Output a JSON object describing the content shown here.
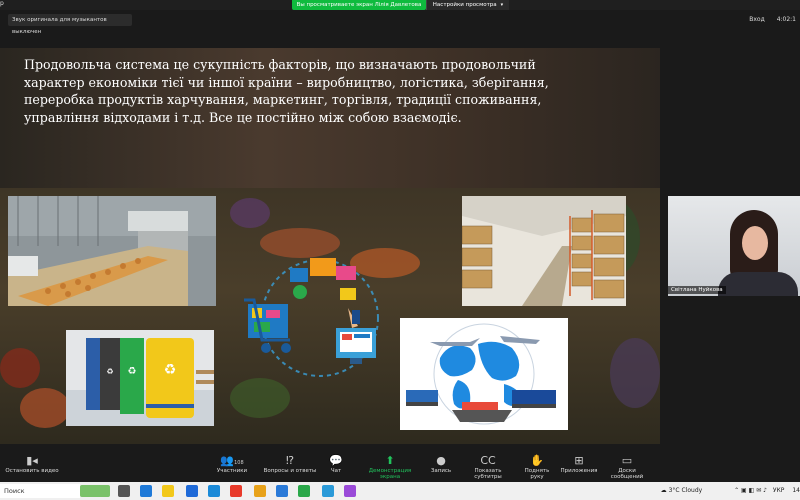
{
  "window": {
    "title_fragment": "р"
  },
  "banner": {
    "text": "Вы просматриваете экран Лілія Давлетова",
    "view_options": "Настройки просмотра"
  },
  "sound_notice": "Звук оригинала для музыкантов выключен",
  "top_right": {
    "enter_label": "Вход",
    "time": "4:02:1"
  },
  "slide": {
    "text": "Продовольча система це сукупність факторів, що визначають продовольчий характер економіки тієї чи іншої країни – виробництво, логістика, зберігання, переробка продуктів харчування, маркетинг, торгівля, традиції споживання, управління відходами і т.д. Все це постійно між собою взаємодіє."
  },
  "participant": {
    "name": "Світлана Нуйкова"
  },
  "toolbar": {
    "stop_video": "Остановить видео",
    "participants": "Участники",
    "participants_count": "108",
    "qa": "Вопросы и ответы",
    "chat": "Чат",
    "share": "Демонстрация экрана",
    "record": "Запись",
    "subtitles": "Показать субтитры",
    "raise_hand": "Поднять руку",
    "apps": "Приложения",
    "whiteboards": "Доски сообщений"
  },
  "taskbar": {
    "search": "Поиск",
    "weather": "3°C Cloudy",
    "lang": "УКР",
    "clock": "14"
  },
  "colors": {
    "share_green": "#21c35c",
    "banner_green": "#0fbb3e"
  }
}
